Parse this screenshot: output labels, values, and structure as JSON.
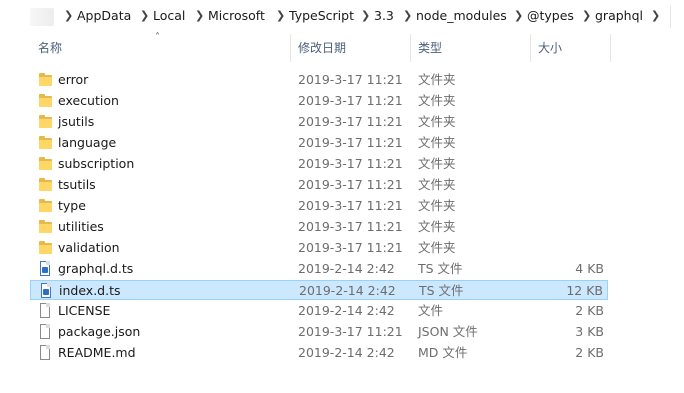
{
  "breadcrumb": [
    "AppData",
    "Local",
    "Microsoft",
    "TypeScript",
    "3.3",
    "node_modules",
    "@types",
    "graphql"
  ],
  "columns": {
    "name": "名称",
    "date": "修改日期",
    "type": "类型",
    "size": "大小"
  },
  "files": [
    {
      "name": "error",
      "date": "2019-3-17 11:21",
      "type": "文件夹",
      "size": "",
      "icon": "folder-icon"
    },
    {
      "name": "execution",
      "date": "2019-3-17 11:21",
      "type": "文件夹",
      "size": "",
      "icon": "folder-icon"
    },
    {
      "name": "jsutils",
      "date": "2019-3-17 11:21",
      "type": "文件夹",
      "size": "",
      "icon": "folder-icon"
    },
    {
      "name": "language",
      "date": "2019-3-17 11:21",
      "type": "文件夹",
      "size": "",
      "icon": "folder-icon"
    },
    {
      "name": "subscription",
      "date": "2019-3-17 11:21",
      "type": "文件夹",
      "size": "",
      "icon": "folder-icon"
    },
    {
      "name": "tsutils",
      "date": "2019-3-17 11:21",
      "type": "文件夹",
      "size": "",
      "icon": "folder-icon"
    },
    {
      "name": "type",
      "date": "2019-3-17 11:21",
      "type": "文件夹",
      "size": "",
      "icon": "folder-icon"
    },
    {
      "name": "utilities",
      "date": "2019-3-17 11:21",
      "type": "文件夹",
      "size": "",
      "icon": "folder-icon"
    },
    {
      "name": "validation",
      "date": "2019-3-17 11:21",
      "type": "文件夹",
      "size": "",
      "icon": "folder-icon"
    },
    {
      "name": "graphql.d.ts",
      "date": "2019-2-14 2:42",
      "type": "TS 文件",
      "size": "4 KB",
      "icon": "ts-file-icon"
    },
    {
      "name": "index.d.ts",
      "date": "2019-2-14 2:42",
      "type": "TS 文件",
      "size": "12 KB",
      "icon": "ts-file-icon",
      "selected": true
    },
    {
      "name": "LICENSE",
      "date": "2019-2-14 2:42",
      "type": "文件",
      "size": "2 KB",
      "icon": "file-icon"
    },
    {
      "name": "package.json",
      "date": "2019-3-17 11:21",
      "type": "JSON 文件",
      "size": "3 KB",
      "icon": "file-icon"
    },
    {
      "name": "README.md",
      "date": "2019-2-14 2:42",
      "type": "MD 文件",
      "size": "2 KB",
      "icon": "file-icon"
    }
  ],
  "colors": {
    "selection_bg": "#cce8ff",
    "selection_border": "#99d1ff",
    "folder": "#ffd766",
    "header_text": "#4c607a"
  }
}
